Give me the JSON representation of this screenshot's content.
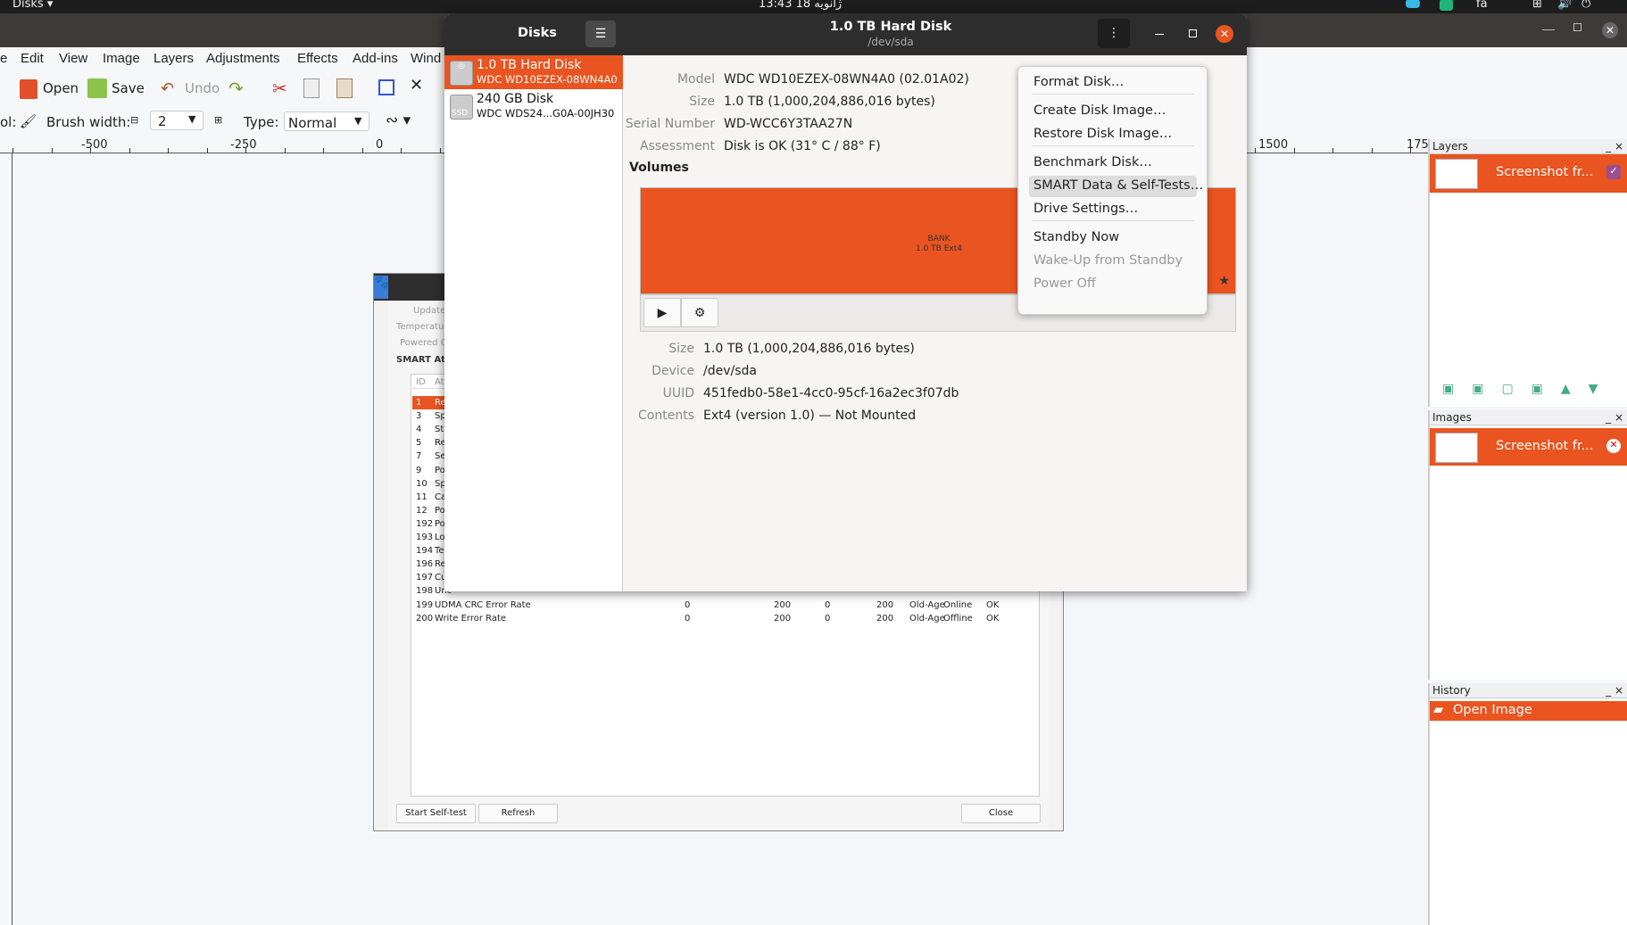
{
  "topbar": {
    "app_menu": "Disks ▾",
    "clock": "13:43  18 ژانویه",
    "lang": "fa"
  },
  "pinta": {
    "menu": [
      "e",
      "Edit",
      "View",
      "Image",
      "Layers",
      "Adjustments",
      "Effects",
      "Add-ins",
      "Wind"
    ],
    "toolbar": {
      "open": "Open",
      "save": "Save",
      "undo": "Undo"
    },
    "options": {
      "tool_label": "ol:",
      "brush_width_label": "Brush width:",
      "brush_width": "2",
      "type_label": "Type:",
      "type_value": "Normal"
    },
    "ruler": [
      "-500",
      "-250",
      "0",
      "1500",
      "175"
    ],
    "panels": {
      "layers": {
        "title": "Layers",
        "item": "Screenshot fr..."
      },
      "images": {
        "title": "Images",
        "item": "Screenshot fr..."
      },
      "history": {
        "title": "History",
        "item": "Open Image"
      }
    }
  },
  "smart_dialog": {
    "labels": [
      "Update",
      "Temperatur",
      "Powered O"
    ],
    "section": "SMART Att",
    "columns": [
      "ID",
      "At"
    ],
    "rows": [
      {
        "id": "1",
        "name": "Rea"
      },
      {
        "id": "3",
        "name": "Spi"
      },
      {
        "id": "4",
        "name": "Sta"
      },
      {
        "id": "5",
        "name": "Rea"
      },
      {
        "id": "7",
        "name": "See"
      },
      {
        "id": "9",
        "name": "Pow"
      },
      {
        "id": "10",
        "name": "Spi"
      },
      {
        "id": "11",
        "name": "Cal"
      },
      {
        "id": "12",
        "name": "Pow"
      },
      {
        "id": "192",
        "name": "Pow"
      },
      {
        "id": "193",
        "name": "Loa"
      },
      {
        "id": "194",
        "name": "Ten"
      },
      {
        "id": "196",
        "name": "Rea"
      },
      {
        "id": "197",
        "name": "Cur"
      },
      {
        "id": "198",
        "name": "Unc"
      },
      {
        "id": "199",
        "name": "UDMA CRC Error Rate",
        "value": "0",
        "normalized": "200",
        "worst": "0",
        "threshold": "200",
        "type": "Old-Age",
        "updates": "Online",
        "assessment": "OK"
      },
      {
        "id": "200",
        "name": "Write Error Rate",
        "value": "0",
        "normalized": "200",
        "worst": "0",
        "threshold": "200",
        "type": "Old-Age",
        "updates": "Offline",
        "assessment": "OK"
      }
    ],
    "buttons": {
      "self_test": "Start Self-test",
      "refresh": "Refresh",
      "close": "Close"
    }
  },
  "disks": {
    "sidebar_title": "Disks",
    "title": "1.0 TB Hard Disk",
    "subtitle": "/dev/sda",
    "drives": [
      {
        "name": "1.0 TB Hard Disk",
        "model": "WDC WD10EZEX-08WN4A0",
        "selected": true
      },
      {
        "name": "240 GB Disk",
        "model": "WDC WDS24...G0A-00JH30",
        "badge": "SSD"
      }
    ],
    "info": [
      {
        "label": "Model",
        "value": "WDC WD10EZEX-08WN4A0 (02.01A02)"
      },
      {
        "label": "Size",
        "value": "1.0 TB (1,000,204,886,016 bytes)"
      },
      {
        "label": "Serial Number",
        "value": "WD-WCC6Y3TAA27N"
      },
      {
        "label": "Assessment",
        "value": "Disk is OK (31° C / 88° F)"
      }
    ],
    "volumes_title": "Volumes",
    "volume": {
      "name": "BANK",
      "desc": "1.0 TB Ext4"
    },
    "volume_info": [
      {
        "label": "Size",
        "value": "1.0 TB (1,000,204,886,016 bytes)"
      },
      {
        "label": "Device",
        "value": "/dev/sda"
      },
      {
        "label": "UUID",
        "value": "451fedb0-58e1-4cc0-95cf-16a2ec3f07db"
      },
      {
        "label": "Contents",
        "value": "Ext4 (version 1.0) — Not Mounted"
      }
    ],
    "menu": [
      {
        "label": "Format Disk…"
      },
      {
        "label": "Create Disk Image…"
      },
      {
        "label": "Restore Disk Image…"
      },
      {
        "label": "Benchmark Disk…"
      },
      {
        "label": "SMART Data & Self-Tests…",
        "hover": true
      },
      {
        "label": "Drive Settings…"
      },
      {
        "label": "Standby Now"
      },
      {
        "label": "Wake-Up from Standby",
        "disabled": true
      },
      {
        "label": "Power Off",
        "disabled": true
      }
    ]
  },
  "colors": {
    "accent": "#e95420",
    "header": "#2d2d2d"
  }
}
